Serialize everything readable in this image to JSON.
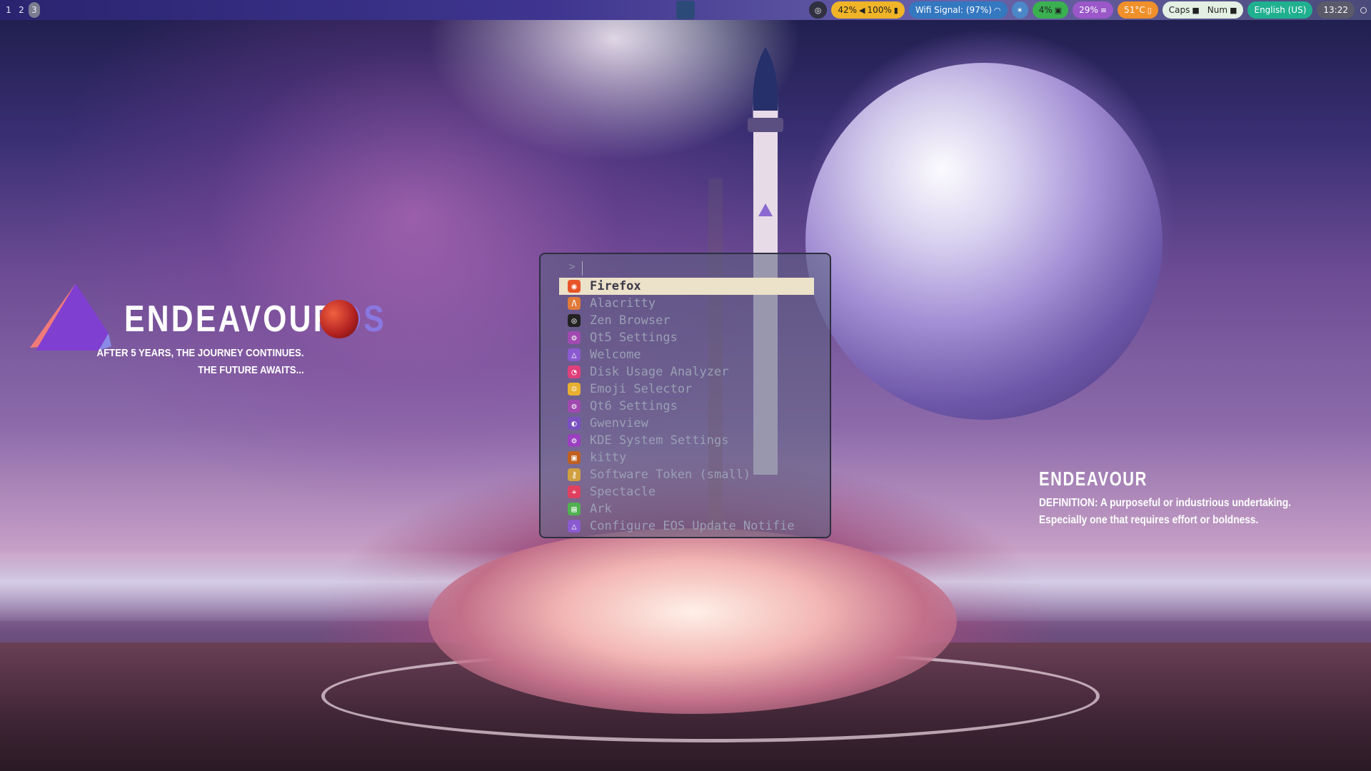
{
  "topbar": {
    "workspaces": [
      "1",
      "2",
      "3"
    ],
    "active_workspace": "3",
    "audio": {
      "volume": "42%",
      "mic": "100%"
    },
    "wifi": "Wifi Signal: (97%)",
    "cpu": "4%",
    "memory": "29%",
    "temperature": "51°C",
    "caps": "Caps",
    "num": "Num",
    "language": "English (US)",
    "clock": "13:22"
  },
  "wallpaper": {
    "logo_word": "ENDEAVOUR",
    "logo_os": "OS",
    "tagline_1": "AFTER 5 YEARS, THE JOURNEY CONTINUES.",
    "tagline_2": "THE FUTURE AWAITS...",
    "def_title": "ENDEAVOUR",
    "def_line_1": "DEFINITION: A purposeful or industrious undertaking.",
    "def_line_2": "Especially one that requires effort or boldness."
  },
  "launcher": {
    "prompt": ">",
    "query": "",
    "entries": [
      {
        "label": "Firefox",
        "icon": "firefox-icon",
        "color": "#e8542a"
      },
      {
        "label": "Alacritty",
        "icon": "alacritty-icon",
        "color": "#e07a3a"
      },
      {
        "label": "Zen Browser",
        "icon": "zen-browser-icon",
        "color": "#222222"
      },
      {
        "label": "Qt5 Settings",
        "icon": "qt5-settings-icon",
        "color": "#a04ab0"
      },
      {
        "label": "Welcome",
        "icon": "endeavouros-icon",
        "color": "#8a5ad0"
      },
      {
        "label": "Disk Usage Analyzer",
        "icon": "disk-usage-icon",
        "color": "#e0407a"
      },
      {
        "label": "Emoji Selector",
        "icon": "emoji-icon",
        "color": "#e8b030"
      },
      {
        "label": "Qt6 Settings",
        "icon": "qt6-settings-icon",
        "color": "#a04ab0"
      },
      {
        "label": "Gwenview",
        "icon": "gwenview-icon",
        "color": "#7a50c0"
      },
      {
        "label": "KDE System Settings",
        "icon": "kde-settings-icon",
        "color": "#9a40c0"
      },
      {
        "label": "kitty",
        "icon": "kitty-icon",
        "color": "#c06020"
      },
      {
        "label": "Software Token (small)",
        "icon": "key-icon",
        "color": "#d0a040"
      },
      {
        "label": "Spectacle",
        "icon": "spectacle-icon",
        "color": "#e04060"
      },
      {
        "label": "Ark",
        "icon": "ark-icon",
        "color": "#50b050"
      },
      {
        "label": "Configure EOS Update Notifie",
        "icon": "endeavouros-icon",
        "color": "#8a5ad0"
      }
    ],
    "selected_index": 0
  }
}
